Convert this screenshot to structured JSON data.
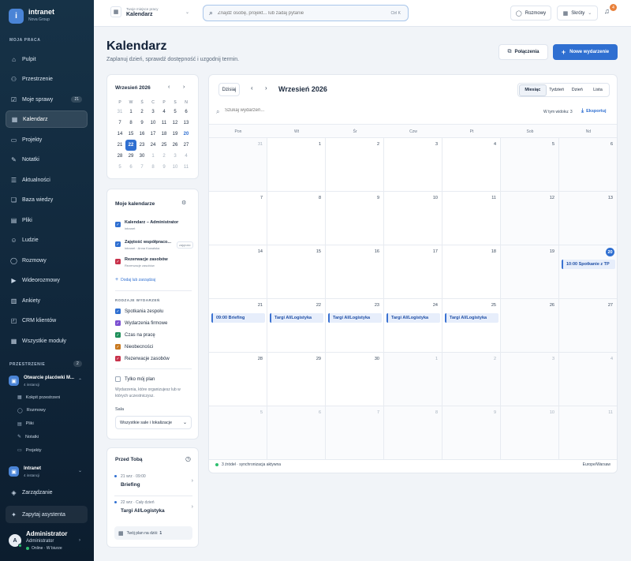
{
  "sidebar": {
    "brand": "intranet",
    "org": "Nova Group",
    "logo_letter": "i",
    "section_main": "MOJA PRACA",
    "items": [
      {
        "label": "Pulpit",
        "icon": "home-icon"
      },
      {
        "label": "Przestrzenie",
        "icon": "spaces-icon"
      },
      {
        "label": "Moje sprawy",
        "icon": "tasks-icon",
        "badge": "21"
      },
      {
        "label": "Kalendarz",
        "icon": "calendar-icon",
        "active": true
      },
      {
        "label": "Projekty",
        "icon": "folder-icon"
      },
      {
        "label": "Notatki",
        "icon": "notes-icon"
      },
      {
        "label": "Aktualności",
        "icon": "news-icon"
      },
      {
        "label": "Baza wiedzy",
        "icon": "book-icon"
      },
      {
        "label": "Pliki",
        "icon": "file-icon"
      },
      {
        "label": "Ludzie",
        "icon": "people-icon"
      },
      {
        "label": "Rozmowy",
        "icon": "chat-icon"
      },
      {
        "label": "Wideorozmowy",
        "icon": "video-icon"
      },
      {
        "label": "Ankiety",
        "icon": "poll-icon"
      },
      {
        "label": "CRM klientów",
        "icon": "crm-icon"
      },
      {
        "label": "Wszystkie moduły",
        "icon": "grid-icon"
      }
    ],
    "section_spaces": "PRZESTRZENIE",
    "spaces_count": "2",
    "space1": {
      "name": "Otwarcie placówki M...",
      "sub": "4 instancji"
    },
    "space1_items": [
      "Kokpit przestrzeni",
      "Rozmowy",
      "Pliki",
      "Notatki",
      "Projekty"
    ],
    "space2": {
      "name": "Intranet",
      "sub": "4 instancji"
    },
    "manage": "Zarządzanie",
    "assistant": "Zapytaj asystenta",
    "user": {
      "avatar": "A",
      "name": "Administrator",
      "role": "Administrator",
      "status": "Online · W biurze"
    }
  },
  "topbar": {
    "workspace_label": "Twoje miejsce pracy",
    "workspace_value": "Kalendarz",
    "search_placeholder": "Znajdź osobę, projekt... lub zadaj pytanie",
    "search_shortcut": "Ctrl K",
    "chat_label": "Rozmowy",
    "shortcuts_label": "Skróty",
    "notif_count": "4"
  },
  "page": {
    "title": "Kalendarz",
    "subtitle": "Zaplanuj dzień, sprawdź dostępność i uzgodnij termin.",
    "connections_btn": "Połączenia",
    "new_event_btn": "Nowe wydarzenie"
  },
  "mini_cal": {
    "title": "Wrzesień 2026",
    "weekdays": [
      "P",
      "W",
      "Ś",
      "C",
      "P",
      "S",
      "N"
    ],
    "weeks": [
      [
        "31",
        "1",
        "2",
        "3",
        "4",
        "5",
        "6"
      ],
      [
        "7",
        "8",
        "9",
        "10",
        "11",
        "12",
        "13"
      ],
      [
        "14",
        "15",
        "16",
        "17",
        "18",
        "19",
        "20"
      ],
      [
        "21",
        "22",
        "23",
        "24",
        "25",
        "26",
        "27"
      ],
      [
        "28",
        "29",
        "30",
        "1",
        "2",
        "3",
        "4"
      ],
      [
        "5",
        "6",
        "7",
        "8",
        "9",
        "10",
        "11"
      ]
    ]
  },
  "calendars": {
    "title": "Moje kalendarze",
    "items": [
      {
        "name": "Kalendarz – Administrator",
        "sub": "intranet",
        "color": "#2f6fd1"
      },
      {
        "name": "Zajętość współpraco...",
        "sub": "intranet · Anna Kowalska",
        "color": "#2f6fd1",
        "tag": "zajętość"
      },
      {
        "name": "Rezerwacje zasobów",
        "sub": "Rezerwacje zasobów",
        "color": "#c8324b"
      }
    ],
    "add_link": "Dodaj lub zarządzaj",
    "types_title": "RODZAJE WYDARZEŃ",
    "types": [
      {
        "name": "Spotkania zespołu",
        "color": "#2f6fd1"
      },
      {
        "name": "Wydarzenia firmowe",
        "color": "#7b4fd1"
      },
      {
        "name": "Czas na pracę",
        "color": "#1f8f5a"
      },
      {
        "name": "Nieobecności",
        "color": "#c9791f"
      },
      {
        "name": "Rezerwacje zasobów",
        "color": "#c8324b"
      }
    ],
    "only_mine": "Tylko mój plan",
    "only_mine_desc": "Wydarzenia, które organizujesz lub w których uczestniczysz.",
    "room_label": "Sala",
    "room_value": "Wszystkie sale i lokalizacje"
  },
  "upcoming": {
    "title": "Przed Tobą",
    "items": [
      {
        "when": "21 wrz · 09:00",
        "name": "Briefing"
      },
      {
        "when": "22 wrz · Cały dzień",
        "name": "Targi AI/Logistyka"
      }
    ],
    "today_plan": "Twój plan na dziś:",
    "today_count": "1"
  },
  "main_cal": {
    "today_btn": "Dzisiaj",
    "title": "Wrzesień 2026",
    "views": [
      "Miesiąc",
      "Tydzień",
      "Dzień",
      "Lista"
    ],
    "active_view": "Miesiąc",
    "search_placeholder": "Szukaj wydarzeń...",
    "visible_label": "W tym widoku:",
    "visible_count": "3",
    "export": "Eksportuj",
    "weekdays": [
      "Pon",
      "Wt",
      "Śr",
      "Czw",
      "Pt",
      "Sob",
      "Nd"
    ],
    "weeks": [
      [
        "31",
        "1",
        "2",
        "3",
        "4",
        "5",
        "6"
      ],
      [
        "7",
        "8",
        "9",
        "10",
        "11",
        "12",
        "13"
      ],
      [
        "14",
        "15",
        "16",
        "17",
        "18",
        "19",
        "20"
      ],
      [
        "21",
        "22",
        "23",
        "24",
        "25",
        "26",
        "27"
      ],
      [
        "28",
        "29",
        "30",
        "1",
        "2",
        "3",
        "4"
      ],
      [
        "5",
        "6",
        "7",
        "8",
        "9",
        "10",
        "11"
      ]
    ],
    "events": [
      {
        "week": 2,
        "day": 6,
        "label": "10:00 Spotkanie z TP"
      },
      {
        "week": 3,
        "day": 0,
        "label": "09:00 Briefing"
      },
      {
        "week": 3,
        "day": 1,
        "label": "Targi AI/Logistyka"
      },
      {
        "week": 3,
        "day": 2,
        "label": "Targi AI/Logistyka"
      },
      {
        "week": 3,
        "day": 3,
        "label": "Targi AI/Logistyka"
      },
      {
        "week": 3,
        "day": 4,
        "label": "Targi AI/Logistyka"
      }
    ],
    "footer_sources": "3 źródeł · synchronizacja aktywna",
    "timezone": "Europe/Warsaw"
  }
}
